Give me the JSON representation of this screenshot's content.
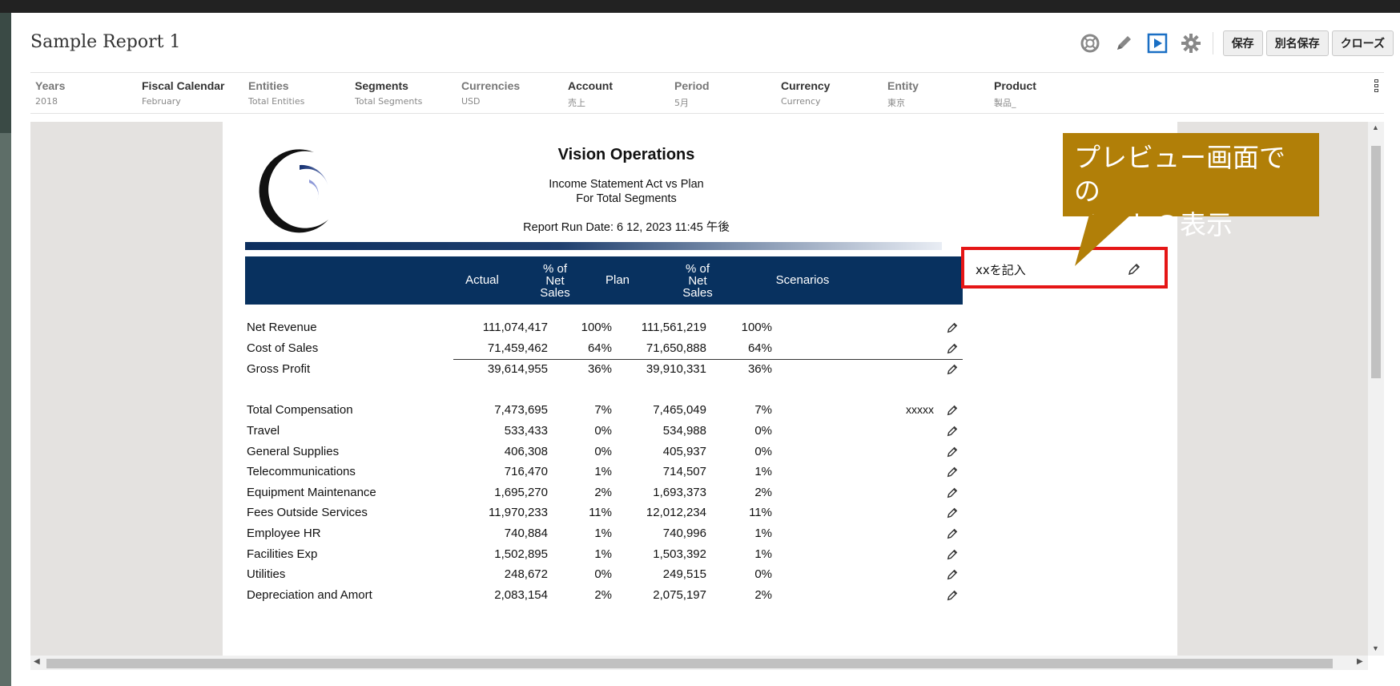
{
  "window": {
    "title": "Sample Report 1"
  },
  "toolbar": {
    "icons": [
      "lifebuoy-icon",
      "pencil-icon",
      "play-icon",
      "gear-icon"
    ],
    "save": "保存",
    "save_as": "別名保存",
    "close": "クローズ"
  },
  "pov": [
    {
      "label": "Years",
      "value": "2018",
      "bold": false
    },
    {
      "label": "Fiscal Calendar",
      "value": "February",
      "bold": true
    },
    {
      "label": "Entities",
      "value": "Total Entities",
      "bold": false
    },
    {
      "label": "Segments",
      "value": "Total Segments",
      "bold": true
    },
    {
      "label": "Currencies",
      "value": "USD",
      "bold": false
    },
    {
      "label": "Account",
      "value": "売上",
      "bold": true
    },
    {
      "label": "Period",
      "value": "5月",
      "bold": false
    },
    {
      "label": "Currency",
      "value": "Currency",
      "bold": true
    },
    {
      "label": "Entity",
      "value": "東京",
      "bold": false
    },
    {
      "label": "Product",
      "value": "製品_",
      "bold": true
    }
  ],
  "report": {
    "title": "Vision Operations",
    "subtitle1": "Income Statement Act vs Plan",
    "subtitle2": "For Total Segments",
    "run_date": "Report Run Date: 6 12, 2023 11:45 午後",
    "header": {
      "actual": "Actual",
      "pct1": [
        "% of",
        "Net",
        "Sales"
      ],
      "plan": "Plan",
      "pct2": [
        "% of",
        "Net",
        "Sales"
      ],
      "scenarios": "Scenarios"
    },
    "rows": [
      {
        "label": "Net Revenue",
        "actual": "111,074,417",
        "pct1": "100%",
        "plan": "111,561,219",
        "pct2": "100%",
        "note": ""
      },
      {
        "label": "Cost of Sales",
        "actual": "71,459,462",
        "pct1": "64%",
        "plan": "71,650,888",
        "pct2": "64%",
        "note": ""
      },
      {
        "label": "Gross Profit",
        "actual": "39,614,955",
        "pct1": "36%",
        "plan": "39,910,331",
        "pct2": "36%",
        "note": ""
      },
      {
        "label": "Total Compensation",
        "actual": "7,473,695",
        "pct1": "7%",
        "plan": "7,465,049",
        "pct2": "7%",
        "note": "xxxxx"
      },
      {
        "label": "Travel",
        "actual": "533,433",
        "pct1": "0%",
        "plan": "534,988",
        "pct2": "0%",
        "note": ""
      },
      {
        "label": "General Supplies",
        "actual": "406,308",
        "pct1": "0%",
        "plan": "405,937",
        "pct2": "0%",
        "note": ""
      },
      {
        "label": "Telecommunications",
        "actual": "716,470",
        "pct1": "1%",
        "plan": "714,507",
        "pct2": "1%",
        "note": ""
      },
      {
        "label": "Equipment Maintenance",
        "actual": "1,695,270",
        "pct1": "2%",
        "plan": "1,693,373",
        "pct2": "2%",
        "note": ""
      },
      {
        "label": "Fees Outside Services",
        "actual": "11,970,233",
        "pct1": "11%",
        "plan": "12,012,234",
        "pct2": "11%",
        "note": ""
      },
      {
        "label": "Employee HR",
        "actual": "740,884",
        "pct1": "1%",
        "plan": "740,996",
        "pct2": "1%",
        "note": ""
      },
      {
        "label": "Facilities Exp",
        "actual": "1,502,895",
        "pct1": "1%",
        "plan": "1,503,392",
        "pct2": "1%",
        "note": ""
      },
      {
        "label": "Utilities",
        "actual": "248,672",
        "pct1": "0%",
        "plan": "249,515",
        "pct2": "0%",
        "note": ""
      },
      {
        "label": "Depreciation and Amort",
        "actual": "2,083,154",
        "pct1": "2%",
        "plan": "2,075,197",
        "pct2": "2%",
        "note": ""
      }
    ]
  },
  "note_panel": {
    "text": "xxを記入"
  },
  "callout": {
    "line1": "プレビュー画面での",
    "line2": "ノートの表示",
    "color": "#b17f08"
  },
  "colors": {
    "header_bg": "#08315f",
    "note_border": "#e51616"
  }
}
